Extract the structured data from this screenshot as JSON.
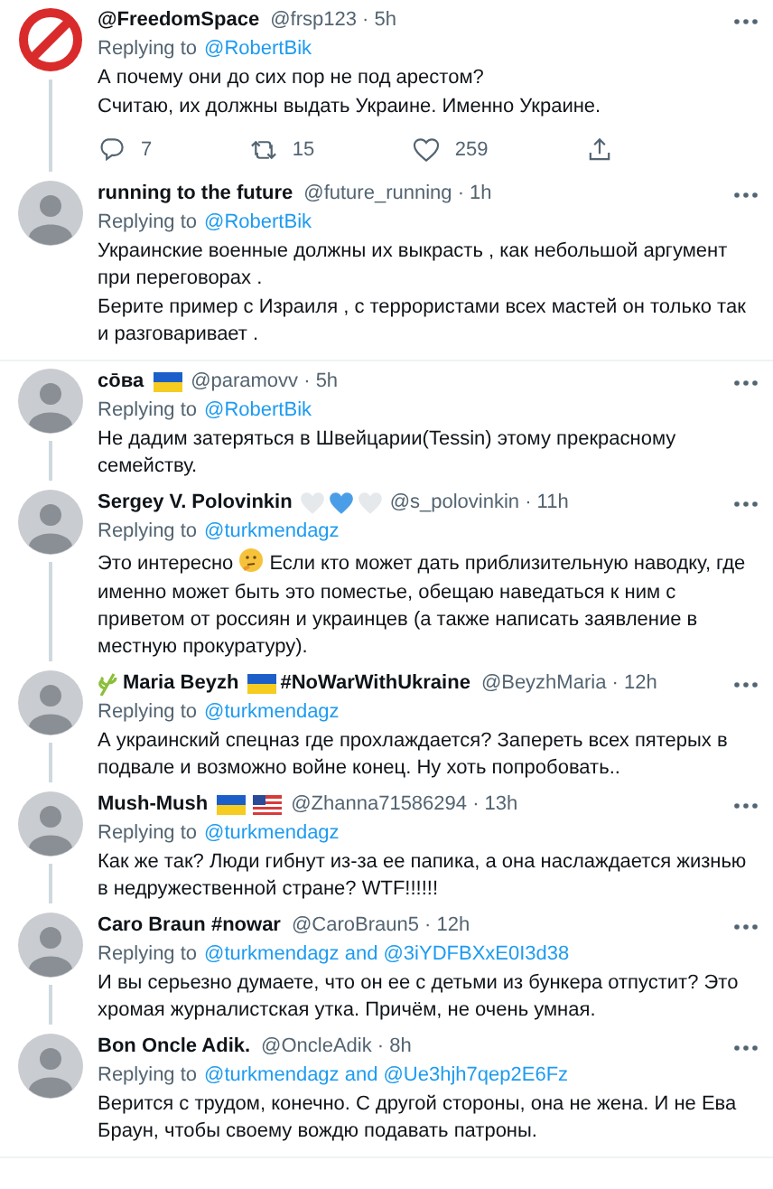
{
  "tweets": [
    {
      "avatar": {
        "kind": "sign"
      },
      "name": [
        {
          "kind": "text",
          "text": "@FreedomSpace"
        }
      ],
      "handle": "@frsp123 · 5h",
      "replying_to": "Replying to",
      "mentions": "@RobertBik",
      "body": [
        [
          {
            "kind": "text",
            "text": "А почему они до сих пор не под арестом?"
          }
        ],
        [
          {
            "kind": "text",
            "text": "Считаю, их должны выдать Украине. Именно Украине."
          }
        ]
      ],
      "actions": [
        {
          "kind": "reply",
          "count": "7"
        },
        {
          "kind": "retweet",
          "count": "15"
        },
        {
          "kind": "like",
          "count": "259"
        },
        {
          "kind": "share"
        }
      ],
      "thread": true
    },
    {
      "avatar": {
        "kind": "photo"
      },
      "name": [
        {
          "kind": "text",
          "text": "running to the future"
        }
      ],
      "handle": "@future_running · 1h",
      "replying_to": "Replying to",
      "mentions": "@RobertBik",
      "body": [
        [
          {
            "kind": "text",
            "text": "Украинские военные должны их выкрасть , как небольшой аргумент при переговорах ."
          }
        ],
        [
          {
            "kind": "text",
            "text": "Берите пример с Израиля , с террористами всех мастей он только так и разговаривает ."
          }
        ]
      ],
      "thread": false
    },
    {
      "avatar": {
        "kind": "photo"
      },
      "name": [
        {
          "kind": "text",
          "text": "cōва"
        },
        {
          "kind": "flag-ua"
        }
      ],
      "handle": "@paramovv · 5h",
      "replying_to": "Replying to",
      "mentions": "@RobertBik",
      "body": [
        [
          {
            "kind": "text",
            "text": "Не дадим затеряться в Швейцарии(Tessin) этому прекрасному семейству."
          }
        ]
      ],
      "thread": true
    },
    {
      "avatar": {
        "kind": "photo"
      },
      "name": [
        {
          "kind": "text",
          "text": "Sergey V. Polovinkin"
        },
        {
          "kind": "heart-white"
        },
        {
          "kind": "heart-blue"
        },
        {
          "kind": "heart-white"
        }
      ],
      "handle": "@s_polovinkin · 11h",
      "replying_to": "Replying to",
      "mentions": "@turkmendagz",
      "body": [
        [
          {
            "kind": "text",
            "text": "Это интересно"
          },
          {
            "kind": "thinking"
          },
          {
            "kind": "text",
            "text": "Если кто может дать приблизительную наводку, где"
          }
        ],
        [
          {
            "kind": "text",
            "text": "именно может быть это поместье, обещаю наведаться к ним с приветом от россиян и украинцев (а также написать заявление в местную прокуратуру)."
          }
        ]
      ],
      "thread": true
    },
    {
      "avatar": {
        "kind": "photo"
      },
      "name": [
        {
          "kind": "plant"
        },
        {
          "kind": "text",
          "text": "Maria Beyzh"
        },
        {
          "kind": "flag-ua"
        },
        {
          "kind": "text",
          "text": "#NoWarWithUkraine"
        }
      ],
      "handle": "@BeyzhMaria · 12h",
      "replying_to": "Replying to",
      "mentions": "@turkmendagz",
      "body": [
        [
          {
            "kind": "text",
            "text": "А украинский спецназ где прохлаждается? Запереть всех пятерых в подвале и возможно войне конец. Ну хоть попробовать.."
          }
        ]
      ],
      "thread": true
    },
    {
      "avatar": {
        "kind": "photo"
      },
      "name": [
        {
          "kind": "text",
          "text": "Mush-Mush"
        },
        {
          "kind": "flag-ua"
        },
        {
          "kind": "flag-us"
        }
      ],
      "handle": "@Zhanna71586294 · 13h",
      "replying_to": "Replying to",
      "mentions": "@turkmendagz",
      "body": [
        [
          {
            "kind": "text",
            "text": "Как же так? Люди гибнут из-за ее папика, а она наслаждается жизнью в недружественной стране? WTF!!!!!!"
          }
        ]
      ],
      "thread": true
    },
    {
      "avatar": {
        "kind": "photo"
      },
      "name": [
        {
          "kind": "text",
          "text": "Caro Braun #nowar"
        }
      ],
      "handle": "@CaroBraun5 · 12h",
      "replying_to": "Replying to",
      "mentions": "@turkmendagz and @3iYDFBXxE0I3d38",
      "body": [
        [
          {
            "kind": "text",
            "text": "И вы серьезно думаете, что он ее с детьми из бункера отпустит? Это хромая журналистская утка. Причём, не очень умная."
          }
        ]
      ],
      "thread": true
    },
    {
      "avatar": {
        "kind": "photo"
      },
      "name": [
        {
          "kind": "text",
          "text": "Bon Oncle Adik."
        }
      ],
      "handle": "@OncleAdik · 8h",
      "replying_to": "Replying to",
      "mentions": "@turkmendagz and @Ue3hjh7qep2E6Fz",
      "body": [
        [
          {
            "kind": "text",
            "text": "Верится с трудом, конечно. С другой стороны, она не жена. И не Ева Браун, чтобы своему вождю подавать патроны."
          }
        ]
      ],
      "thread": false
    }
  ]
}
